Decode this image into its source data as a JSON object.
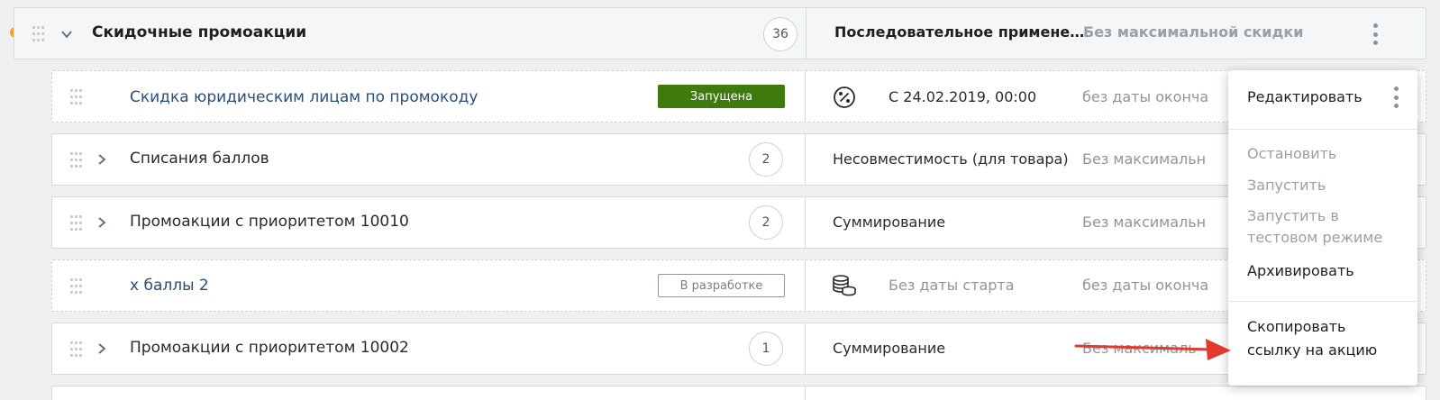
{
  "group": {
    "title": "Скидочные промоакции",
    "count": "36",
    "mode": "Последовательное примене…",
    "max_discount": "Без максимальной скидки"
  },
  "rows": [
    {
      "kind": "promo",
      "title": "Скидка юридическим лицам по промокоду",
      "status": "Запущена",
      "icon": "percent-icon",
      "start": "С 24.02.2019, 00:00",
      "end": "без даты оконча"
    },
    {
      "kind": "group",
      "title": "Списания баллов",
      "count": "2",
      "mode": "Несовместимость (для товара)",
      "max_discount": "Без максимальн"
    },
    {
      "kind": "group",
      "title": "Промоакции с приоритетом 10010",
      "count": "2",
      "mode": "Суммирование",
      "max_discount": "Без максимальн"
    },
    {
      "kind": "promo",
      "title": "х баллы 2",
      "status": "В разработке",
      "icon": "coins-icon",
      "start": "Без даты старта",
      "end": "без даты оконча"
    },
    {
      "kind": "group",
      "title": "Промоакции с приоритетом 10002",
      "count": "1",
      "mode": "Суммирование",
      "max_discount": "Без максималь"
    }
  ],
  "menu": {
    "edit": "Редактировать",
    "stop": "Остановить",
    "start": "Запустить",
    "start_test_line1": "Запустить в",
    "start_test_line2": "тестовом режиме",
    "archive": "Архивировать",
    "copy_line1": "Скопировать",
    "copy_line2": "ссылку на акцию"
  },
  "colors": {
    "running_badge": "#3e7a0d",
    "link": "#2a4e7d",
    "indicator": "#f0a330",
    "arrow": "#e23a2e"
  }
}
